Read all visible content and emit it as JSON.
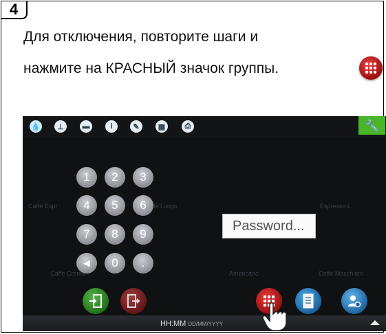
{
  "step": {
    "number": "4"
  },
  "instruction": {
    "line1": "Для отключения, повторите шаги и",
    "line2": "нажмите на КРАСНЫЙ значок группы."
  },
  "device": {
    "toolbar_icons": [
      "drop-icon",
      "clock-icon",
      "folder-icon",
      "info-icon",
      "pencil-icon",
      "calculator-icon",
      "printer-icon"
    ],
    "settings_icon": "wrench-icon",
    "keypad": {
      "keys": [
        "1",
        "2",
        "3",
        "4",
        "5",
        "6",
        "7",
        "8",
        "9",
        "◀",
        "0",
        "."
      ]
    },
    "password_placeholder": "Password...",
    "background_labels": [
      "Caffè Espr",
      "Caffè Lungo",
      "Espresso L",
      "Caffè Crema",
      "Americano",
      "Caffè Macchiato"
    ],
    "actions": [
      "enter-icon",
      "exit-icon",
      "group-icon",
      "document-icon",
      "user-settings-icon"
    ],
    "clock": {
      "time": "HH:MM",
      "date": "DD/MM/YYYY"
    }
  },
  "colors": {
    "group_red": "#d32f2f",
    "settings_green": "#4ab52a",
    "enter_green": "#2e8a25",
    "blue": "#2b80c9"
  }
}
